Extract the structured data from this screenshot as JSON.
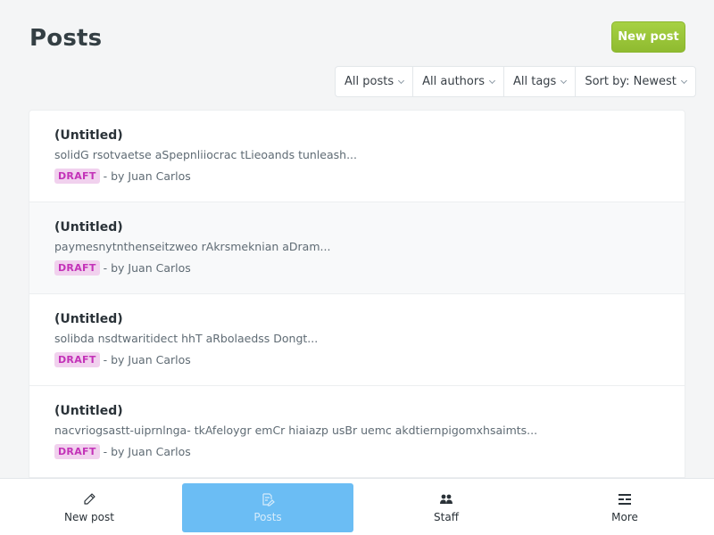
{
  "header": {
    "title": "Posts",
    "new_post_label": "New post"
  },
  "filters": [
    {
      "label": "All posts"
    },
    {
      "label": "All authors"
    },
    {
      "label": "All tags"
    },
    {
      "label": "Sort by: Newest"
    }
  ],
  "posts": [
    {
      "title": "(Untitled)",
      "excerpt": "solidG rsotvaetse aSpepnliiocrac tLieoands tunleash...",
      "status": "DRAFT",
      "byline": "- by Juan Carlos"
    },
    {
      "title": "(Untitled)",
      "excerpt": "paymesnytnthenseitzweo rAkrsmeknian aDram...",
      "status": "DRAFT",
      "byline": "- by Juan Carlos"
    },
    {
      "title": "(Untitled)",
      "excerpt": "solibda nsdtwaritidect hhT aRbolaedss Dongt...",
      "status": "DRAFT",
      "byline": "- by Juan Carlos"
    },
    {
      "title": "(Untitled)",
      "excerpt": "nacvriogsastt-uiprnlnga- tkAfeloygr emCr hiaiazp usBr uemc akdtiernpigomxhsaimts...",
      "status": "DRAFT",
      "byline": "- by Juan Carlos"
    }
  ],
  "bottom_nav": [
    {
      "label": "New post",
      "icon": "pencil-icon",
      "active": false
    },
    {
      "label": "Posts",
      "icon": "document-edit-icon",
      "active": true
    },
    {
      "label": "Staff",
      "icon": "users-icon",
      "active": false
    },
    {
      "label": "More",
      "icon": "menu-icon",
      "active": false
    }
  ],
  "colors": {
    "primary_button": "#9ac63a",
    "draft_badge_bg": "#f1d1ee",
    "draft_badge_text": "#c332b8",
    "nav_active": "#6bbdf4"
  }
}
